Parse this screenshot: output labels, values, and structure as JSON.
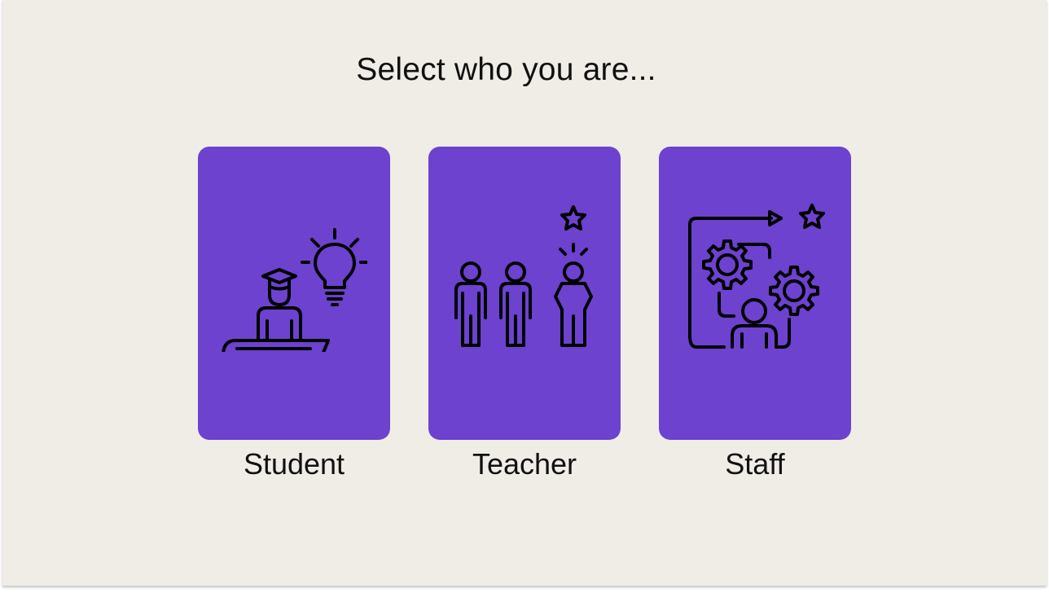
{
  "heading": "Select who you are...",
  "card_color": "#6c42cf",
  "background_color": "#efede6",
  "roles": [
    {
      "label": "Student",
      "icon": "student-book-lightbulb-icon"
    },
    {
      "label": "Teacher",
      "icon": "teacher-star-icon"
    },
    {
      "label": "Staff",
      "icon": "staff-gears-icon"
    }
  ]
}
